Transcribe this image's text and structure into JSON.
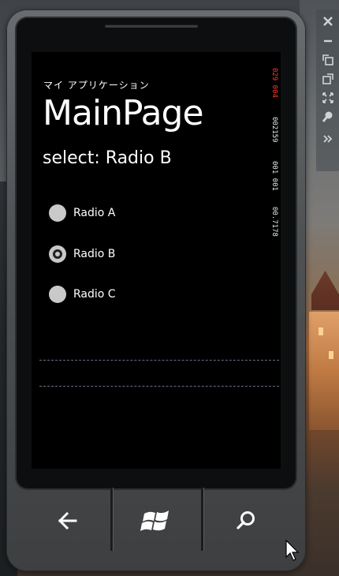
{
  "app": {
    "app_title": "マイ アプリケーション",
    "page_title": "MainPage",
    "selection_text": "select: Radio B"
  },
  "radios": [
    {
      "label": "Radio A",
      "checked": false
    },
    {
      "label": "Radio B",
      "checked": true
    },
    {
      "label": "Radio C",
      "checked": false
    }
  ],
  "frame_counters": [
    {
      "text": "029 004",
      "color": "#ff3b2f"
    },
    {
      "text": "002159",
      "color": "#e8e8e8"
    },
    {
      "text": "001 001",
      "color": "#e8e8e8"
    },
    {
      "text": "00.7178",
      "color": "#e8e8e8"
    }
  ],
  "hardware_buttons": [
    "back-icon",
    "windows-icon",
    "search-icon"
  ],
  "emulator_tools": [
    "close-icon",
    "minimize-icon",
    "rotate-left-icon",
    "rotate-right-icon",
    "fit-to-screen-icon",
    "zoom-icon",
    "more-icon"
  ]
}
